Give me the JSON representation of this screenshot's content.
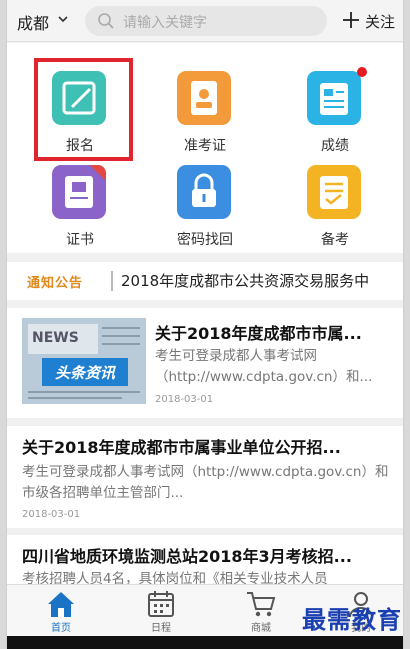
{
  "header": {
    "city": "成都",
    "search_placeholder": "请输入关键字",
    "follow_label": "关注"
  },
  "grid": {
    "items": [
      {
        "label": "报名",
        "icon": "signup-pencil-icon",
        "color": "#3fc0b5"
      },
      {
        "label": "准考证",
        "icon": "admission-card-icon",
        "color": "#f39a3a"
      },
      {
        "label": "成绩",
        "icon": "score-document-icon",
        "color": "#2bb3e6"
      },
      {
        "label": "证书",
        "icon": "certificate-icon",
        "color": "#8a64c9"
      },
      {
        "label": "密码找回",
        "icon": "lock-icon",
        "color": "#3b8ee0"
      },
      {
        "label": "备考",
        "icon": "prep-clipboard-icon",
        "color": "#f3b323"
      }
    ]
  },
  "notice": {
    "badge": "通知公告",
    "text": "2018年度成都市公共资源交易服务中"
  },
  "news": [
    {
      "title": "关于2018年度成都市市属...",
      "desc": "考生可登录成都人事考试网（http://www.cdpta.gov.cn）和...",
      "date": "2018-03-01",
      "thumb_caption": "头条资讯",
      "thumb_text": "NEWS"
    },
    {
      "title": "关于2018年度成都市市属事业单位公开招...",
      "desc": "考生可登录成都人事考试网（http://www.cdpta.gov.cn）和市级各招聘单位主管部门...",
      "date": "2018-03-01"
    },
    {
      "title": "四川省地质环境监测总站2018年3月考核招...",
      "desc": "考核招聘人员4名，具体岗位和《相关专业技术人员"
    }
  ],
  "bottom_nav": [
    {
      "label": "首页",
      "icon": "home-icon",
      "active": true
    },
    {
      "label": "日程",
      "icon": "calendar-icon",
      "active": false
    },
    {
      "label": "商城",
      "icon": "cart-icon",
      "active": false
    },
    {
      "label": "我的",
      "icon": "user-icon",
      "active": false
    }
  ],
  "watermark": "最需教育"
}
